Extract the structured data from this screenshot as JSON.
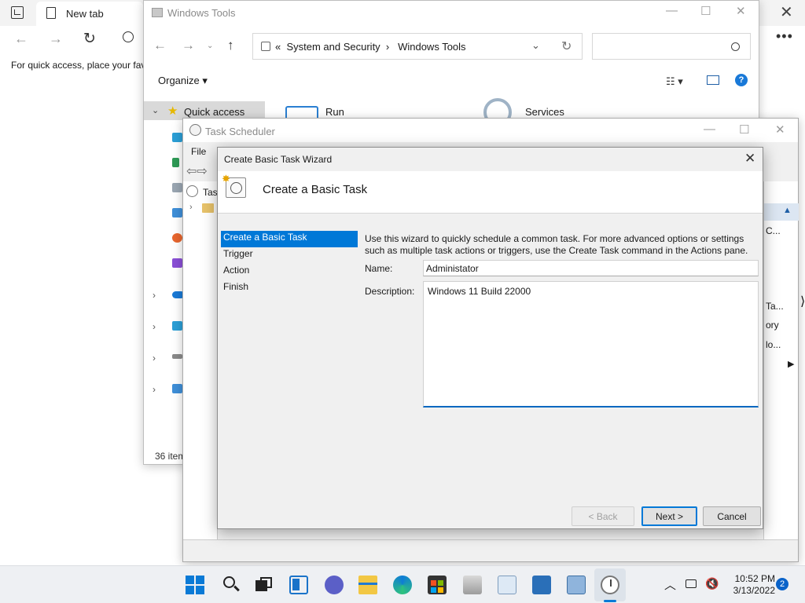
{
  "browser": {
    "tab_title": "New tab",
    "favorites_hint": "For quick access, place your fav"
  },
  "explorer": {
    "title": "Windows Tools",
    "breadcrumb_prefix": "«",
    "breadcrumb": [
      "System and Security",
      "Windows Tools"
    ],
    "organize_label": "Organize ▾",
    "nav_pane": {
      "quick_access_label": "Quick access"
    },
    "items": [
      {
        "label": "Run",
        "icon": "run-icon"
      },
      {
        "label": "Services",
        "icon": "services-gear-icon"
      }
    ],
    "status_text": "36 item"
  },
  "task_scheduler": {
    "title": "Task Scheduler",
    "menu_file": "File",
    "tree_label": "Task",
    "actions_truncated": [
      "C...",
      "Ta...",
      "ory",
      "lo..."
    ]
  },
  "wizard": {
    "title": "Create Basic Task Wizard",
    "heading": "Create a Basic Task",
    "steps": [
      {
        "label": "Create a Basic Task",
        "active": true
      },
      {
        "label": "Trigger",
        "active": false
      },
      {
        "label": "Action",
        "active": false
      },
      {
        "label": "Finish",
        "active": false
      }
    ],
    "intro_line1": "Use this wizard to quickly schedule a common task.  For more advanced options or settings",
    "intro_line2": "such as multiple task actions or triggers, use the Create Task command in the Actions pane.",
    "name_label": "Name:",
    "name_value": "Administator",
    "description_label": "Description:",
    "description_value": "Windows 11 Build 22000",
    "back_label": "< Back",
    "next_label": "Next >",
    "cancel_label": "Cancel",
    "accent_color": "#0078d7"
  },
  "taskbar": {
    "time": "10:52 PM",
    "date": "3/13/2022",
    "notification_count": "2"
  }
}
